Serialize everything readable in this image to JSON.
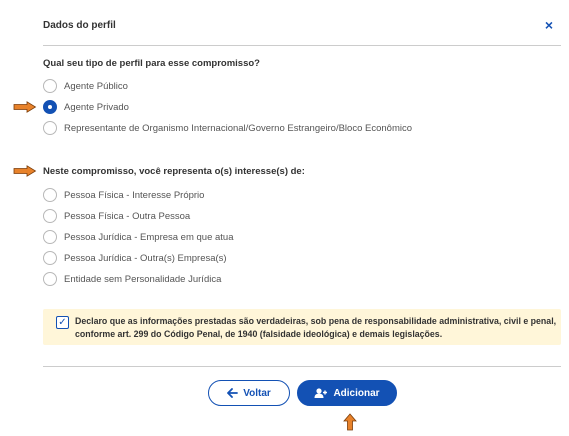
{
  "header": {
    "title": "Dados do perfil",
    "close_glyph": "×"
  },
  "profile_section": {
    "question": "Qual seu tipo de perfil para esse compromisso?",
    "options": [
      {
        "label": "Agente Público",
        "selected": false
      },
      {
        "label": "Agente Privado",
        "selected": true
      },
      {
        "label": "Representante de Organismo Internacional/Governo Estrangeiro/Bloco Econômico",
        "selected": false
      }
    ]
  },
  "interest_section": {
    "question": "Neste compromisso, você representa o(s) interesse(s) de:",
    "options": [
      {
        "label": "Pessoa Física - Interesse Próprio",
        "selected": false
      },
      {
        "label": "Pessoa Física - Outra Pessoa",
        "selected": false
      },
      {
        "label": "Pessoa Jurídica - Empresa em que atua",
        "selected": false
      },
      {
        "label": "Pessoa Jurídica - Outra(s) Empresa(s)",
        "selected": false
      },
      {
        "label": "Entidade sem Personalidade Jurídica",
        "selected": false
      }
    ]
  },
  "declaration": {
    "checked": true,
    "check_glyph": "✓",
    "text": "Declaro que as informações prestadas são verdadeiras, sob pena de responsabilidade administrativa, civil e penal, conforme art. 299 do Código Penal, de 1940 (falsidade ideológica) e demais legislações."
  },
  "footer": {
    "back_label": "Voltar",
    "add_label": "Adicionar"
  },
  "colors": {
    "primary": "#1351b4",
    "annotation_arrow": "#e8822a",
    "declaration_bg": "#fff6d9"
  },
  "icons": {
    "close": "close-icon",
    "back": "arrow-left-icon",
    "add": "user-plus-icon",
    "annotation": "orange-arrow-icon"
  }
}
